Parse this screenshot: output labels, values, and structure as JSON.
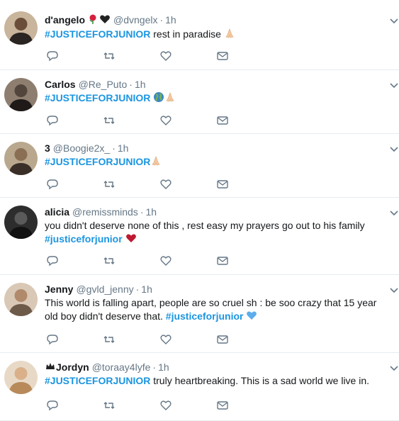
{
  "tweets": [
    {
      "name": "d'angelo",
      "name_emojis": [
        "rose-emoji",
        "black-heart-emoji"
      ],
      "handle": "@dvngelx",
      "time": "1h",
      "segments": [
        {
          "text": "#JUSTICEFORJUNIOR",
          "tag": true
        },
        {
          "text": " rest in paradise ",
          "tag": false
        }
      ],
      "emojis": [
        "folded-hands-emoji"
      ]
    },
    {
      "name": "Carlos",
      "handle": "@Re_Puto",
      "time": "1h",
      "segments": [
        {
          "text": "#JUSTICEFORJUNIOR",
          "tag": true
        },
        {
          "text": " ",
          "tag": false
        }
      ],
      "emojis": [
        "globe-emoji",
        "folded-hands-emoji"
      ]
    },
    {
      "name": "3",
      "handle": "@Boogie2x_",
      "time": "1h",
      "segments": [
        {
          "text": "#JUSTICEFORJUNIOR",
          "tag": true
        }
      ],
      "emojis": [
        "folded-hands-emoji"
      ]
    },
    {
      "name": "alicia",
      "handle": "@remissminds",
      "time": "1h",
      "segments": [
        {
          "text": "you didn't deserve none of this , rest easy my prayers go out to his family ",
          "tag": false
        },
        {
          "text": "#justiceforjunior",
          "tag": true
        },
        {
          "text": " ",
          "tag": false
        }
      ],
      "emojis": [
        "red-heart-emoji"
      ]
    },
    {
      "name": "Jenny",
      "handle": "@gvld_jenny",
      "time": "1h",
      "segments": [
        {
          "text": "This world is falling apart, people are so cruel sh : be soo crazy that 15 year old boy didn't deserve that. ",
          "tag": false
        },
        {
          "text": "#justiceforjunior",
          "tag": true
        },
        {
          "text": " ",
          "tag": false
        }
      ],
      "emojis": [
        "blue-heart-emoji"
      ]
    },
    {
      "name": "Jordyn",
      "name_prefix_emoji": "crown-emoji",
      "handle": "@toraay4lyfe",
      "time": "1h",
      "segments": [
        {
          "text": "#JUSTICEFORJUNIOR",
          "tag": true
        },
        {
          "text": " truly heartbreaking. This is a sad world we live in.",
          "tag": false
        }
      ],
      "emojis": []
    }
  ],
  "actions": [
    "reply-icon",
    "retweet-icon",
    "like-icon",
    "dm-icon"
  ],
  "colors": {
    "hashtag": "#1b95e0",
    "meta": "#657786",
    "divider": "#e6ecf0",
    "action": "#657786"
  }
}
